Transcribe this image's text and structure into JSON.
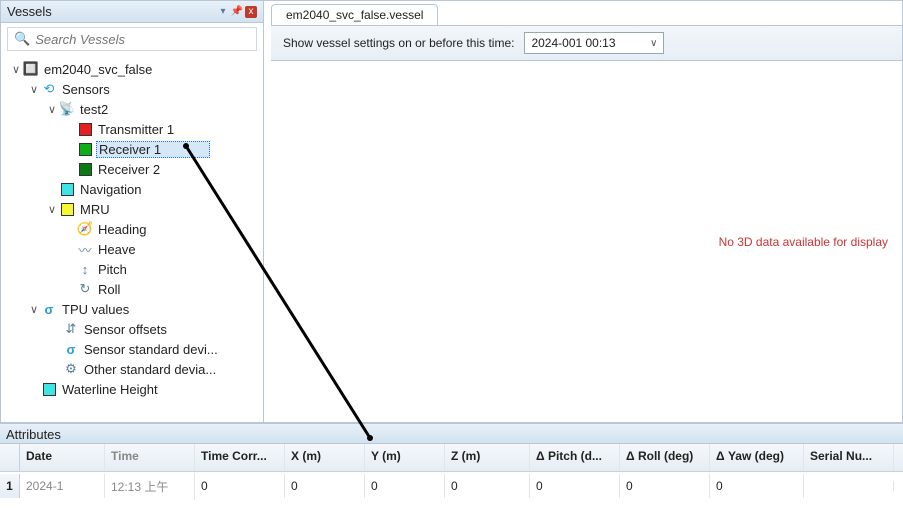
{
  "panel": {
    "title": "Vessels",
    "search_placeholder": "Search Vessels"
  },
  "tree": {
    "root": "em2040_svc_false",
    "sensors": "Sensors",
    "test2": "test2",
    "transmitter1": "Transmitter 1",
    "receiver1": "Receiver 1",
    "receiver2": "Receiver 2",
    "navigation": "Navigation",
    "mru": "MRU",
    "heading": "Heading",
    "heave": "Heave",
    "pitch": "Pitch",
    "roll": "Roll",
    "tpu": "TPU values",
    "sensor_offsets": "Sensor offsets",
    "sensor_std": "Sensor standard devi...",
    "other_std": "Other standard devia...",
    "waterline": "Waterline Height"
  },
  "tab": {
    "label": "em2040_svc_false.vessel"
  },
  "settings": {
    "label": "Show vessel settings on or before this time:",
    "value": "2024-001 00:13"
  },
  "viewer": {
    "no3d": "No 3D data available for display"
  },
  "attributes": {
    "title": "Attributes",
    "headers": {
      "date": "Date",
      "time": "Time",
      "tc": "Time Corr...",
      "x": "X (m)",
      "y": "Y (m)",
      "z": "Z (m)",
      "dp": "Δ Pitch (d...",
      "dr": "Δ Roll (deg)",
      "dy": "Δ Yaw (deg)",
      "sn": "Serial Nu..."
    },
    "row": {
      "num": "1",
      "date": "2024-1",
      "time": "12:13 上午",
      "tc": "0",
      "x": "0",
      "y": "0",
      "z": "0",
      "dp": "0",
      "dr": "0",
      "dy": "0",
      "sn": ""
    }
  },
  "colors": {
    "red": "#e62020",
    "green": "#0bb019",
    "darkgreen": "#0a7a14",
    "cyan": "#3fe4e4",
    "yellow": "#f7f733"
  }
}
